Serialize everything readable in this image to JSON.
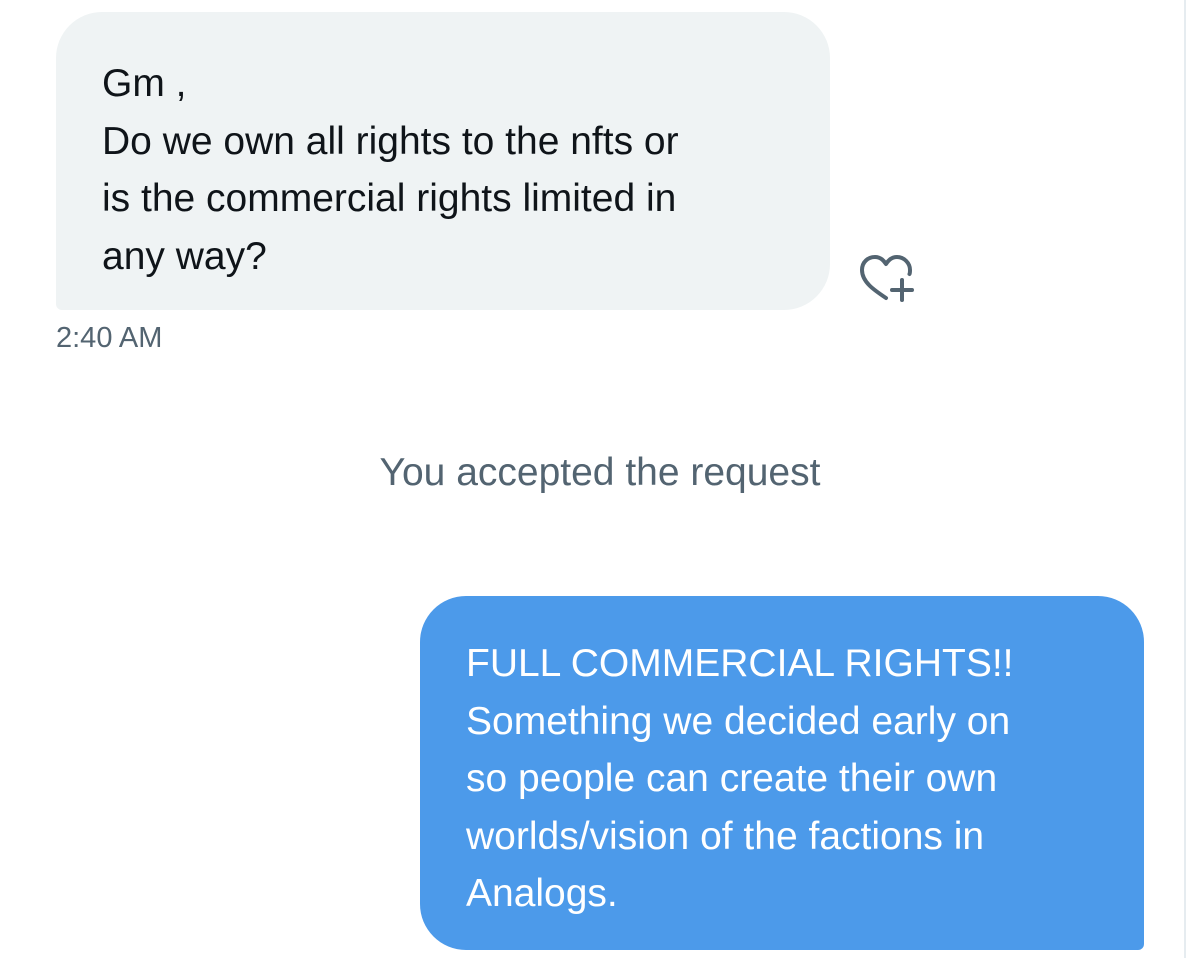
{
  "conversation": {
    "incoming": {
      "lines": [
        "Gm ,",
        "Do we own all rights to the nfts or",
        "is the commercial rights limited in",
        "any way?"
      ],
      "timestamp": "2:40 AM",
      "react_icon": "heart-plus-icon"
    },
    "system_message": "You accepted the request",
    "outgoing": {
      "lines": [
        "FULL COMMERCIAL RIGHTS!!",
        "Something we decided early on",
        "so people can create their own",
        "worlds/vision of the factions in",
        "Analogs."
      ]
    }
  },
  "colors": {
    "incoming_bubble": "#eff3f4",
    "outgoing_bubble": "#4c9aea",
    "secondary_text": "#536471",
    "primary_text": "#0f1419"
  }
}
